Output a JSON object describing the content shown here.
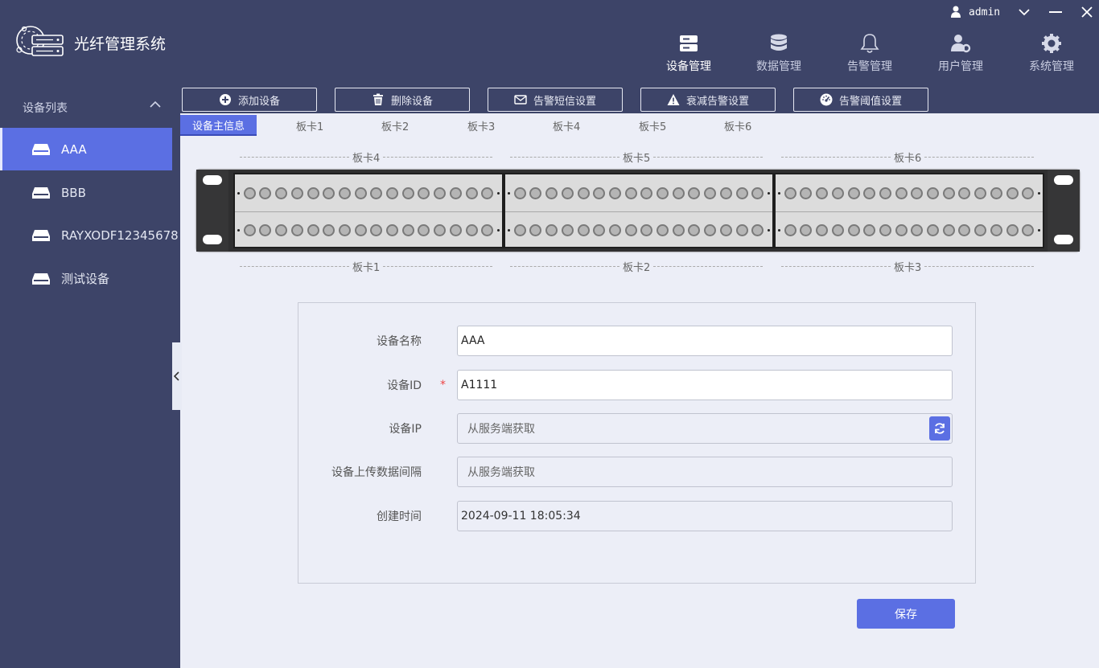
{
  "app": {
    "title": "光纤管理系统"
  },
  "window": {
    "user": "admin"
  },
  "nav": [
    {
      "label": "设备管理",
      "icon": "server-icon",
      "active": true
    },
    {
      "label": "数据管理",
      "icon": "database-icon"
    },
    {
      "label": "告警管理",
      "icon": "bell-icon"
    },
    {
      "label": "用户管理",
      "icon": "user-settings-icon"
    },
    {
      "label": "系统管理",
      "icon": "gear-icon"
    }
  ],
  "sidebar": {
    "title": "设备列表",
    "devices": [
      {
        "label": "AAA",
        "active": true
      },
      {
        "label": "BBB"
      },
      {
        "label": "RAYXODF12345678"
      },
      {
        "label": "测试设备"
      }
    ]
  },
  "toolbar": {
    "add": "添加设备",
    "delete": "删除设备",
    "sms": "告警短信设置",
    "attenuation": "衰减告警设置",
    "threshold": "告警阈值设置"
  },
  "tabs": [
    "设备主信息",
    "板卡1",
    "板卡2",
    "板卡3",
    "板卡4",
    "板卡5",
    "板卡6"
  ],
  "rack": {
    "top_labels": [
      "板卡4",
      "板卡5",
      "板卡6"
    ],
    "bottom_labels": [
      "板卡1",
      "板卡2",
      "板卡3"
    ]
  },
  "form": {
    "name_label": "设备名称",
    "name_value": "AAA",
    "id_label": "设备ID",
    "id_required": "*",
    "id_value": "A1111",
    "ip_label": "设备IP",
    "ip_value": "从服务端获取",
    "interval_label": "设备上传数据间隔",
    "interval_value": "从服务端获取",
    "created_label": "创建时间",
    "created_value": "2024-09-11 18:05:34"
  },
  "save_label": "保存",
  "colors": {
    "accent": "#5b6fe3",
    "chrome": "#3d4468",
    "content": "#eceef7"
  }
}
